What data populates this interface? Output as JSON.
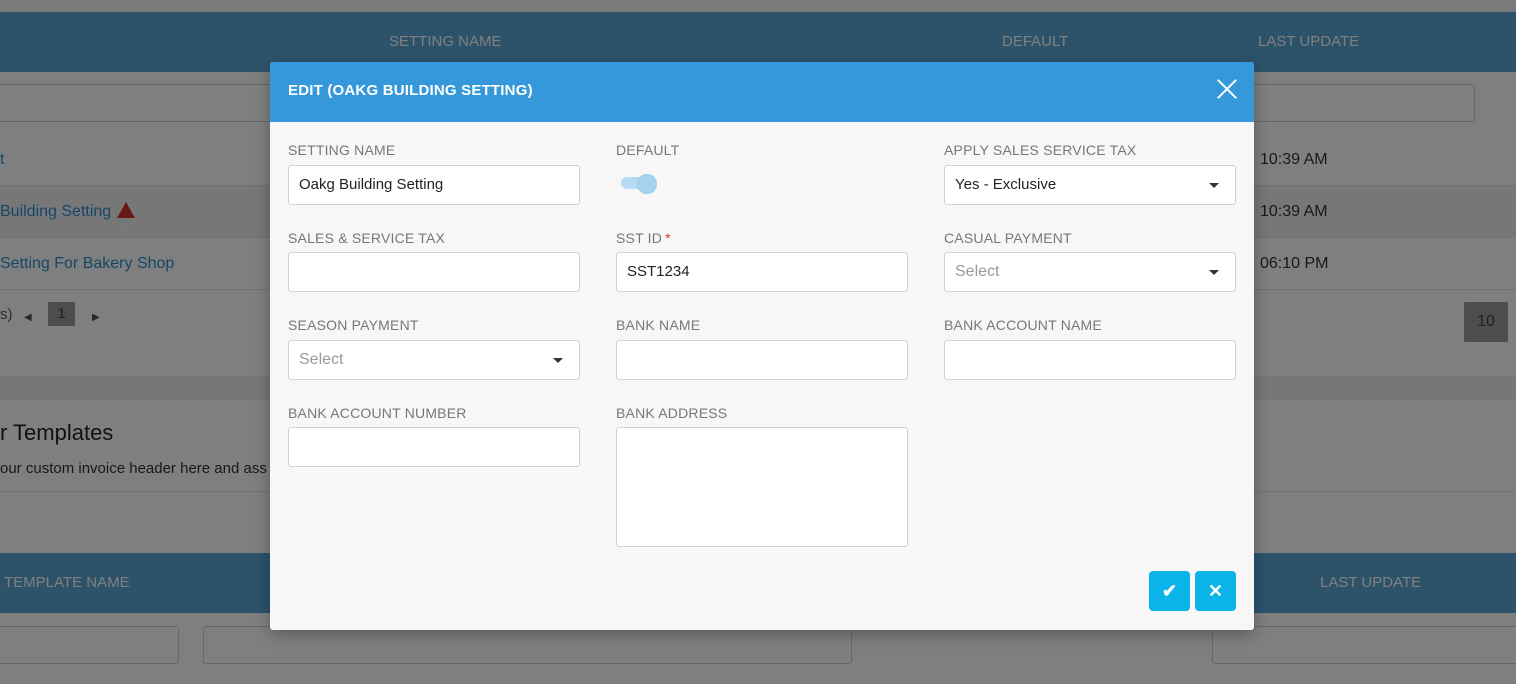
{
  "background": {
    "table1": {
      "columns": [
        "SETTING NAME",
        "DEFAULT",
        "LAST UPDATE"
      ],
      "rows": [
        {
          "name": "t",
          "time": "10:39 AM",
          "warning": false
        },
        {
          "name": "Building Setting",
          "time": "10:39 AM",
          "warning": true
        },
        {
          "name": "Setting For Bakery Shop",
          "time": "06:10 PM",
          "warning": false
        }
      ],
      "pager": {
        "prefix": "s)",
        "prev_icon": "chevron-left-icon",
        "page": "1",
        "next_icon": "chevron-right-icon",
        "page_size": "10"
      }
    },
    "section": {
      "title": "r Templates",
      "description": "our custom invoice header here and ass"
    },
    "table2": {
      "columns": [
        "TEMPLATE NAME",
        "LAST UPDATE"
      ]
    }
  },
  "modal": {
    "title": "EDIT (OAKG BUILDING SETTING)",
    "close_icon": "close-icon",
    "fields": {
      "setting_name": {
        "label": "SETTING NAME",
        "value": "Oakg Building Setting"
      },
      "default": {
        "label": "DEFAULT",
        "on": true
      },
      "apply_sst": {
        "label": "APPLY SALES SERVICE TAX",
        "value": "Yes - Exclusive"
      },
      "sales_service_tax": {
        "label": "SALES & SERVICE TAX",
        "value": ""
      },
      "sst_id": {
        "label": "SST ID",
        "required_mark": "*",
        "value": "SST1234"
      },
      "casual_payment": {
        "label": "CASUAL PAYMENT",
        "placeholder": "Select"
      },
      "season_payment": {
        "label": "SEASON PAYMENT",
        "placeholder": "Select"
      },
      "bank_name": {
        "label": "BANK NAME",
        "value": ""
      },
      "bank_account_name": {
        "label": "BANK ACCOUNT NAME",
        "value": ""
      },
      "bank_account_number": {
        "label": "BANK ACCOUNT NUMBER",
        "value": ""
      },
      "bank_address": {
        "label": "BANK ADDRESS",
        "value": ""
      }
    },
    "actions": {
      "save": {
        "glyph": "✔",
        "icon": "check-icon"
      },
      "cancel": {
        "glyph": "✕",
        "icon": "x-icon"
      }
    }
  },
  "colors": {
    "header_blue": "#3498db",
    "table_header_blue": "#5aa6d6",
    "action_button": "#0ab4e8",
    "link_blue": "#2f8fcf",
    "required_red": "#e0312d"
  }
}
